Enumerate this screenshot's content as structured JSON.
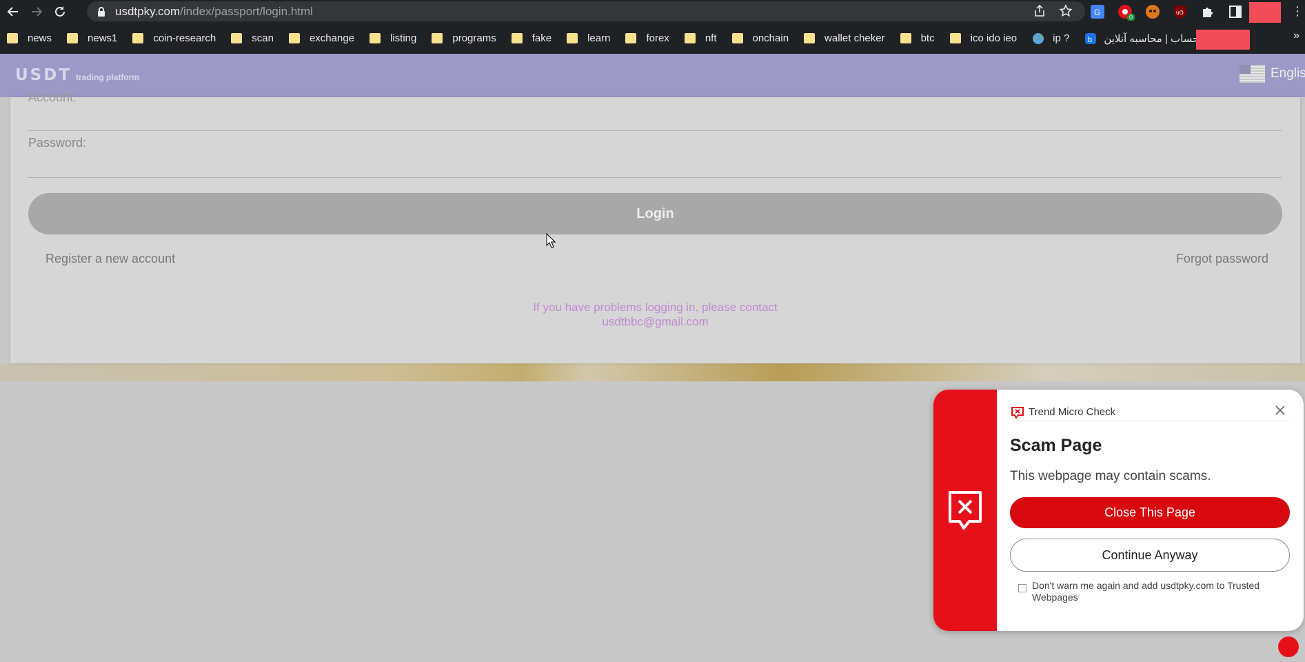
{
  "browser": {
    "url_domain": "usdtpky.com",
    "url_path": "/index/passport/login.html",
    "extensions": {
      "translate_icon": "google-translate-icon",
      "badge_count": "0"
    }
  },
  "bookmarks": [
    {
      "label": "news",
      "icon": "folder-icon"
    },
    {
      "label": "news1",
      "icon": "folder-icon"
    },
    {
      "label": "coin-research",
      "icon": "folder-icon"
    },
    {
      "label": "scan",
      "icon": "folder-icon"
    },
    {
      "label": "exchange",
      "icon": "folder-icon"
    },
    {
      "label": "listing",
      "icon": "folder-icon"
    },
    {
      "label": "programs",
      "icon": "folder-icon"
    },
    {
      "label": "fake",
      "icon": "folder-icon"
    },
    {
      "label": "learn",
      "icon": "folder-icon"
    },
    {
      "label": "forex",
      "icon": "folder-icon"
    },
    {
      "label": "nft",
      "icon": "folder-icon"
    },
    {
      "label": "onchain",
      "icon": "folder-icon"
    },
    {
      "label": "wallet cheker",
      "icon": "folder-icon"
    },
    {
      "label": "btc",
      "icon": "folder-icon"
    },
    {
      "label": "ico ido ieo",
      "icon": "folder-icon"
    },
    {
      "label": "ip ?",
      "icon": "globe-icon"
    },
    {
      "label": "باحساب | محاسبه آنلاین",
      "icon": "site-icon"
    }
  ],
  "bookmarks_more": "»",
  "site": {
    "logo": "USDT",
    "logo_sub": "trading platform",
    "language": "Englis"
  },
  "login": {
    "account_label": "Account:",
    "password_label": "Password:",
    "login_button": "Login",
    "register_link": "Register a new account",
    "forgot_link": "Forgot password",
    "contact_line1": "If you have problems logging in, please contact",
    "contact_email": "usdtbbc@gmail.com"
  },
  "trendmicro": {
    "brand": "Trend Micro Check",
    "title": "Scam Page",
    "message": "This webpage may contain scams.",
    "close_button": "Close This Page",
    "continue_button": "Continue Anyway",
    "checkbox_text": "Don't warn me again and add usdtpky.com to Trusted Webpages"
  }
}
